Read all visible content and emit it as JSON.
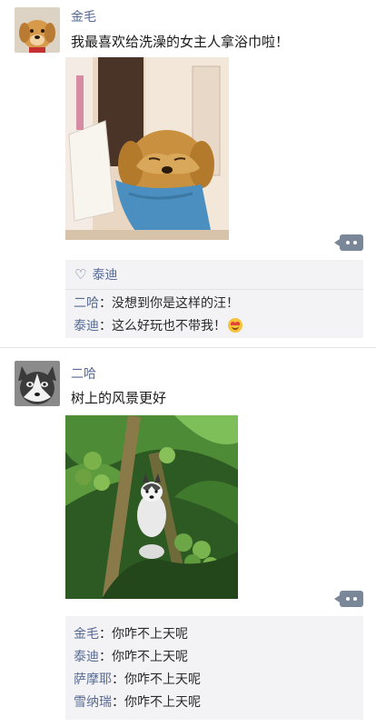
{
  "posts": [
    {
      "author": "金毛",
      "avatar_icon": "golden-retriever-avatar",
      "text": "我最喜欢给洗澡的女主人拿浴巾啦！",
      "photo": "golden-retriever-with-blue-towel",
      "likes": [
        "泰迪"
      ],
      "comments": [
        {
          "name": "二哈",
          "sep": "：",
          "text": "没想到你是这样的汪！",
          "emoji": ""
        },
        {
          "name": "泰迪",
          "sep": "：",
          "text": "这么好玩也不带我！",
          "emoji": "heart-eyes-emoji"
        }
      ]
    },
    {
      "author": "二哈",
      "avatar_icon": "husky-avatar",
      "text": "树上的风景更好",
      "photo": "husky-in-coconut-tree",
      "comments": [
        {
          "name": "金毛",
          "sep": "：",
          "text": "你咋不上天呢"
        },
        {
          "name": "泰迪",
          "sep": "：",
          "text": "你咋不上天呢"
        },
        {
          "name": "萨摩耶",
          "sep": "：",
          "text": "你咋不上天呢"
        },
        {
          "name": "雪纳瑞",
          "sep": "：",
          "text": "你咋不上天呢"
        }
      ]
    }
  ],
  "colors": {
    "name_link": "#576b95",
    "comment_bg": "#f3f3f5",
    "more_button": "#7a8798"
  }
}
